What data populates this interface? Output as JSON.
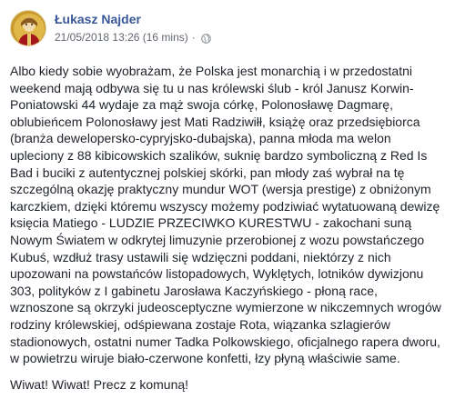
{
  "post": {
    "author": "Łukasz Najder",
    "timestamp": "21/05/2018 13:26 (16 mins)",
    "separator": "·",
    "privacy_icon": "globe-icon",
    "avatar_icon": "profile-avatar-icon",
    "paragraphs": [
      "Albo kiedy sobie wyobrażam, że Polska jest monarchią i w przedostatni weekend mają odbywa się tu u nas królewski ślub - król Janusz Korwin-Poniatowski 44 wydaje za mąż swoja córkę, Polonosławę Dagmarę, oblubieńcem Polonosławy jest Mati Radziwiłł, książę oraz przedsiębiorca (branża dewelopersko-cypryjsko-dubajska), panna młoda ma welon upleciony z 88 kibicowskich szalików, suknię bardzo symboliczną z Red Is Bad i buciki z autentycznej polskiej skórki, pan młody zaś wybrał na tę szczególną okazję praktyczny mundur WOT (wersja prestige) z obniżonym karczkiem, dzięki któremu wszyscy możemy podziwiać wytatuowaną dewizę księcia Matiego - LUDZIE PRZECIWKO KURESTWU - zakochani suną Nowym Światem w odkrytej limuzynie przerobionej z wozu powstańczego Kubuś, wzdłuż trasy ustawili się wdzięczni poddani, niektórzy z nich upozowani na powstańców listopadowych, Wyklętych, lotników dywizjonu 303, polityków z I gabinetu Jarosława Kaczyńskiego - płoną race, wznoszone są okrzyki judeosceptyczne wymierzone w nikczemnych wrogów rodziny królewskiej, odśpiewana zostaje Rota, wiązanka szlagierów stadionowych, ostatni numer Tadka Polkowskiego, oficjalnego rapera dworu, w powietrzu wiruje biało-czerwone konfetti, łzy płyną właściwie same.",
      "Wiwat! Wiwat! Precz z komuną!"
    ]
  },
  "colors": {
    "author_link": "#385898",
    "meta_text": "#616770",
    "body_text": "#1d2129"
  }
}
